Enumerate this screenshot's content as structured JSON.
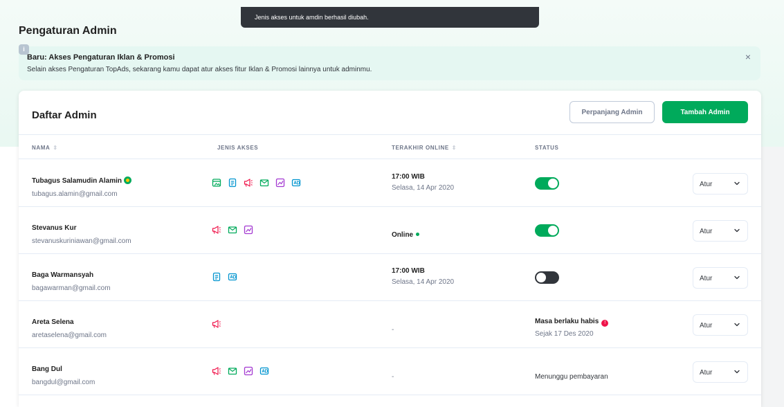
{
  "toast": {
    "message": "Jenis akses untuk amdin berhasil diubah."
  },
  "page": {
    "title": "Pengaturan Admin"
  },
  "banner": {
    "icon": "info-icon",
    "title": "Baru: Akses Pengaturan Iklan & Promosi",
    "description": "Selain akses Pengaturan TopAds, sekarang kamu dapat atur akses fitur Iklan & Promosi lainnya untuk adminmu.",
    "close_label": "×"
  },
  "card": {
    "title": "Daftar Admin",
    "extend_button": "Perpanjang Admin",
    "add_button": "Tambah Admin"
  },
  "table": {
    "headers": {
      "name": "NAMA",
      "access": "JENIS AKSES",
      "last_online": "TERAKHIR ONLINE",
      "status": "STATUS"
    },
    "action_label": "Atur",
    "rows": [
      {
        "name": "Tubagus Salamudin Alamin",
        "email": "tubagus.alamin@gmail.com",
        "owner_badge": true,
        "access_icons": [
          "store-icon",
          "clipboard-icon",
          "megaphone-icon",
          "mail-icon",
          "chart-icon",
          "ads-icon"
        ],
        "time": "17:00 WIB",
        "date": "Selasa, 14 Apr 2020",
        "status_type": "toggle",
        "toggle_on": true
      },
      {
        "name": "Stevanus Kur",
        "email": "stevanuskuriniawan@gmail.com",
        "owner_badge": false,
        "access_icons": [
          "megaphone-icon",
          "mail-icon",
          "chart-icon"
        ],
        "online_label": "Online",
        "status_type": "toggle",
        "toggle_on": true
      },
      {
        "name": "Baga Warmansyah",
        "email": "bagawarman@gmail.com",
        "owner_badge": false,
        "access_icons": [
          "clipboard-icon",
          "ads-icon"
        ],
        "time": "17:00 WIB",
        "date": "Selasa, 14 Apr 2020",
        "status_type": "toggle",
        "toggle_on": false
      },
      {
        "name": "Areta Selena",
        "email": "aretaselena@gmail.com",
        "owner_badge": false,
        "access_icons": [
          "megaphone-icon"
        ],
        "dash": "-",
        "status_type": "expired",
        "status_title": "Masa berlaku habis",
        "status_sub": "Sejak 17 Des 2020"
      },
      {
        "name": "Bang Dul",
        "email": "bangdul@gmail.com",
        "owner_badge": false,
        "access_icons": [
          "megaphone-icon",
          "mail-icon",
          "chart-icon",
          "ads-icon"
        ],
        "dash": "-",
        "status_type": "pending",
        "status_title": "Menunggu pembayaran"
      }
    ]
  },
  "colors": {
    "primary_green": "#00aa5b",
    "store": "#00aa5b",
    "clipboard": "#0094cf",
    "megaphone": "#ef144a",
    "mail": "#00aa5b",
    "chart": "#a339d1",
    "ads": "#0094cf",
    "warning": "#ef144a"
  }
}
